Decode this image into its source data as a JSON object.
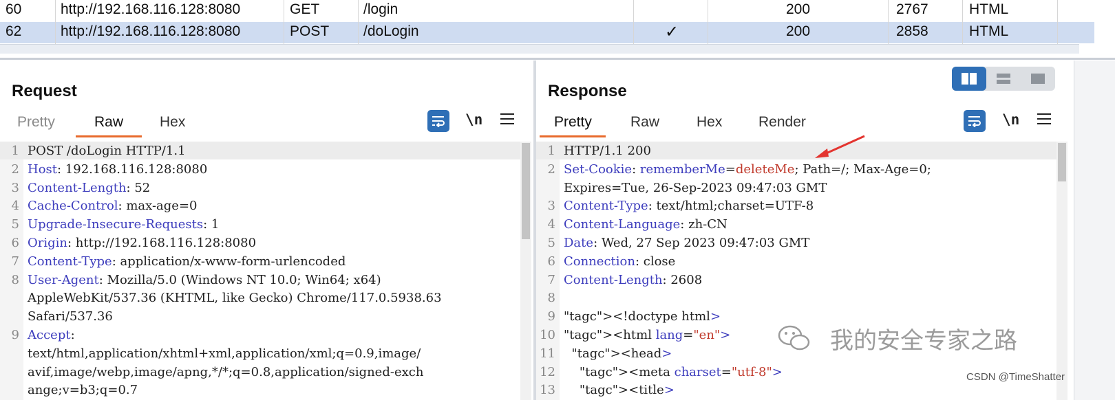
{
  "history": {
    "rows": [
      {
        "num": "60",
        "host": "http://192.168.116.128:8080",
        "method": "GET",
        "url": "/login",
        "edited": "",
        "status": "200",
        "length": "2767",
        "mime": "HTML",
        "selected": false
      },
      {
        "num": "62",
        "host": "http://192.168.116.128:8080",
        "method": "POST",
        "url": "/doLogin",
        "edited": "✓",
        "status": "200",
        "length": "2858",
        "mime": "HTML",
        "selected": true
      }
    ]
  },
  "request": {
    "title": "Request",
    "tabs": [
      "Pretty",
      "Raw",
      "Hex"
    ],
    "active_tab": "Raw",
    "newline_label": "\\n",
    "lines": [
      {
        "n": "1",
        "text": "POST /doLogin HTTP/1.1"
      },
      {
        "n": "2",
        "key": "Host",
        "text": ": 192.168.116.128:8080"
      },
      {
        "n": "3",
        "key": "Content-Length",
        "text": ": 52"
      },
      {
        "n": "4",
        "key": "Cache-Control",
        "text": ": max-age=0"
      },
      {
        "n": "5",
        "key": "Upgrade-Insecure-Requests",
        "text": ": 1"
      },
      {
        "n": "6",
        "key": "Origin",
        "text": ": http://192.168.116.128:8080"
      },
      {
        "n": "7",
        "key": "Content-Type",
        "text": ": application/x-www-form-urlencoded"
      },
      {
        "n": "8",
        "key": "User-Agent",
        "text": ": Mozilla/5.0 (Windows NT 10.0; Win64; x64)"
      },
      {
        "n": "",
        "text": "AppleWebKit/537.36 (KHTML, like Gecko) Chrome/117.0.5938.63"
      },
      {
        "n": "",
        "text": "Safari/537.36"
      },
      {
        "n": "9",
        "key": "Accept",
        "text": ":"
      },
      {
        "n": "",
        "text": "text/html,application/xhtml+xml,application/xml;q=0.9,image/"
      },
      {
        "n": "",
        "text": "avif,image/webp,image/apng,*/*;q=0.8,application/signed-exch"
      },
      {
        "n": "",
        "text": "ange;v=b3;q=0.7"
      }
    ]
  },
  "response": {
    "title": "Response",
    "tabs": [
      "Pretty",
      "Raw",
      "Hex",
      "Render"
    ],
    "active_tab": "Pretty",
    "newline_label": "\\n",
    "lines": [
      {
        "n": "1",
        "text": "HTTP/1.1 200"
      },
      {
        "n": "2",
        "key": "Set-Cookie",
        "text": ": rememberMe=deleteMe; Path=/; Max-Age=0;"
      },
      {
        "n": "",
        "text": "Expires=Tue, 26-Sep-2023 09:47:03 GMT"
      },
      {
        "n": "3",
        "key": "Content-Type",
        "text": ": text/html;charset=UTF-8"
      },
      {
        "n": "4",
        "key": "Content-Language",
        "text": ": zh-CN"
      },
      {
        "n": "5",
        "key": "Date",
        "text": ": Wed, 27 Sep 2023 09:47:03 GMT"
      },
      {
        "n": "6",
        "key": "Connection",
        "text": ": close"
      },
      {
        "n": "7",
        "key": "Content-Length",
        "text": ": 2608"
      },
      {
        "n": "8",
        "text": ""
      },
      {
        "n": "9",
        "text": "<!doctype html>"
      },
      {
        "n": "10",
        "text": "<html lang=\"en\">"
      },
      {
        "n": "11",
        "text": "  <head>"
      },
      {
        "n": "12",
        "text": "    <meta charset=\"utf-8\">"
      },
      {
        "n": "13",
        "text": "    <title>"
      }
    ]
  },
  "watermark": {
    "text": "我的安全专家之路"
  },
  "credit": "CSDN @TimeShatter",
  "colors": {
    "accent": "#2f6fb6",
    "tab_underline": "#e86a2c",
    "selected_row": "#cfdcf1",
    "header_key": "#3d3dbd",
    "value_highlight": "#c0392b",
    "arrow": "#e3342f"
  }
}
